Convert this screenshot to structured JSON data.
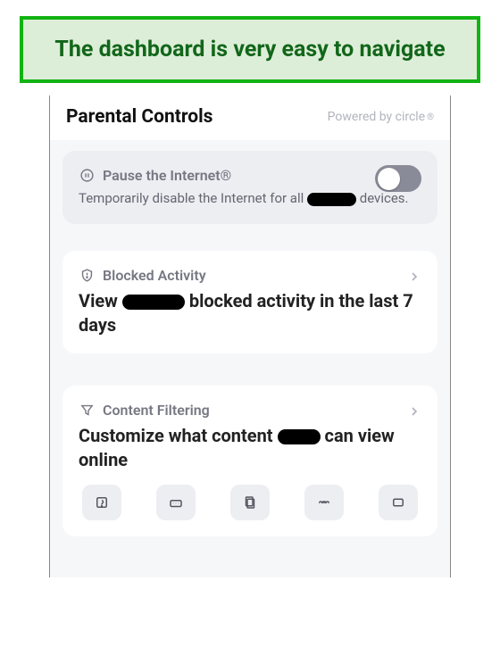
{
  "caption": "The dashboard is very easy to navigate",
  "header": {
    "title": "Parental Controls",
    "poweredBy": "Powered by circle"
  },
  "pause": {
    "title": "Pause the Internet®",
    "description_pre": "Temporarily disable the Internet for all",
    "description_post": "devices.",
    "toggleOn": false
  },
  "blocked": {
    "title": "Blocked Activity",
    "body_pre": "View",
    "body_post": "blocked activity in the last 7 days"
  },
  "filtering": {
    "title": "Content Filtering",
    "body_pre": "Customize what content",
    "body_post": "can view online"
  }
}
